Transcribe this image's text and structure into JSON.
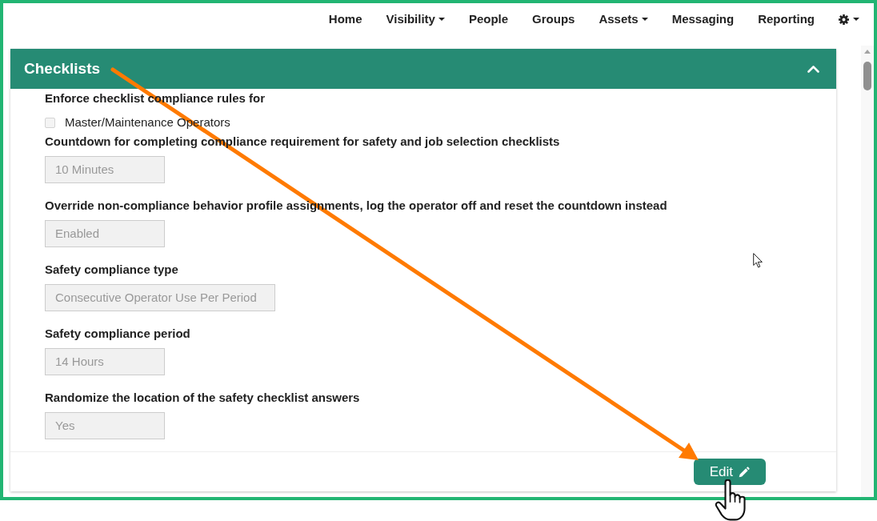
{
  "nav": {
    "items": [
      {
        "kind": "link",
        "label": "Home",
        "dropdown": false
      },
      {
        "kind": "link",
        "label": "Visibility",
        "dropdown": true
      },
      {
        "kind": "link",
        "label": "People",
        "dropdown": false
      },
      {
        "kind": "link",
        "label": "Groups",
        "dropdown": false
      },
      {
        "kind": "link",
        "label": "Assets",
        "dropdown": true
      },
      {
        "kind": "link",
        "label": "Messaging",
        "dropdown": false
      },
      {
        "kind": "link",
        "label": "Reporting",
        "dropdown": false
      },
      {
        "kind": "settings",
        "dropdown": true
      }
    ]
  },
  "panel": {
    "title": "Checklists",
    "expanded": true,
    "fields": [
      {
        "kind": "checkboxes",
        "label": "Enforce checklist compliance rules for",
        "options": [
          {
            "label": "Master/Maintenance Operators",
            "checked": false,
            "disabled": true
          }
        ]
      },
      {
        "kind": "input",
        "label": "Countdown for completing compliance requirement for safety and job selection checklists",
        "value": "10 Minutes",
        "disabled": true
      },
      {
        "kind": "input",
        "label": "Override non-compliance behavior profile assignments, log the operator off and reset the countdown instead",
        "value": "Enabled",
        "disabled": true
      },
      {
        "kind": "input",
        "label": "Safety compliance type",
        "value": "Consecutive Operator Use Per Period",
        "disabled": true
      },
      {
        "kind": "input",
        "label": "Safety compliance period",
        "value": "14 Hours",
        "disabled": true
      },
      {
        "kind": "input",
        "label": "Randomize the location of the safety checklist answers",
        "value": "Yes",
        "disabled": true
      }
    ],
    "edit_button": {
      "label": "Edit"
    }
  }
}
